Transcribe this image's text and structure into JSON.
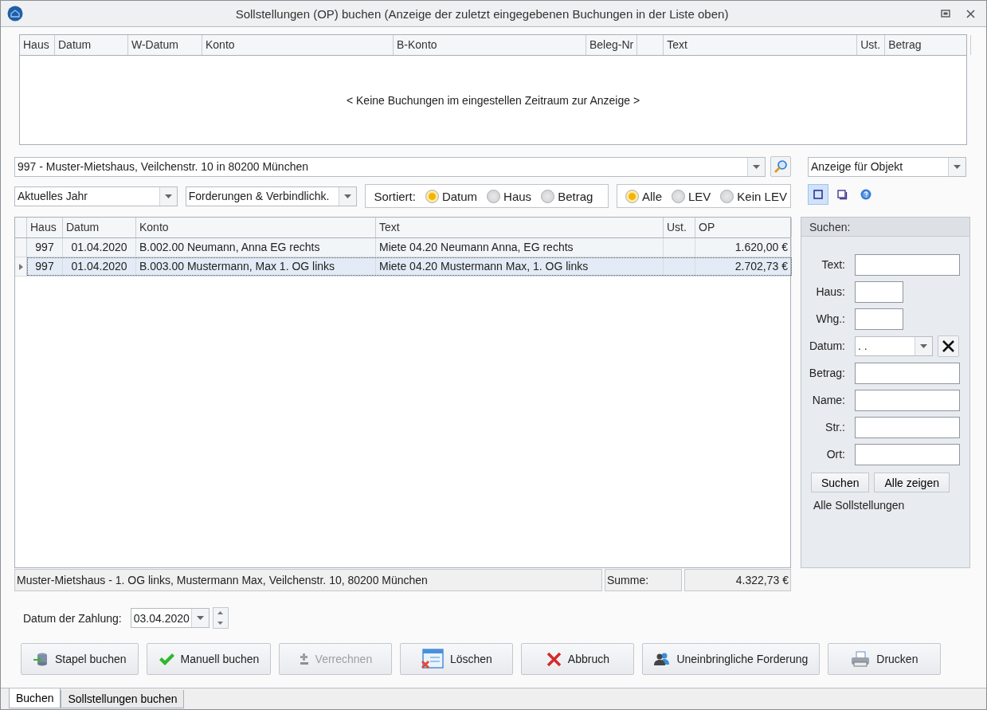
{
  "window": {
    "title": "Sollstellungen (OP) buchen (Anzeige der zuletzt eingegebenen Buchungen in der Liste oben)"
  },
  "top_table": {
    "columns": [
      {
        "label": "Haus"
      },
      {
        "label": "Datum"
      },
      {
        "label": "W-Datum"
      },
      {
        "label": "Konto"
      },
      {
        "label": "B-Konto"
      },
      {
        "label": "Beleg-Nr"
      },
      {},
      {
        "label": "Text"
      },
      {
        "label": "Ust."
      },
      {
        "label": "Betrag"
      }
    ],
    "empty_message": "< Keine Buchungen im eingestellen Zeitraum zur Anzeige >"
  },
  "object_select": {
    "value": "997 - Muster-Mietshaus, Veilchenstr. 10 in 80200 München"
  },
  "view_select": {
    "value": "Anzeige für Objekt"
  },
  "period_select": {
    "value": "Aktuelles Jahr"
  },
  "type_select": {
    "value": "Forderungen & Verbindlichk."
  },
  "sort": {
    "label": "Sortiert:",
    "options": [
      {
        "label": "Datum",
        "selected": true
      },
      {
        "label": "Haus",
        "selected": false
      },
      {
        "label": "Betrag",
        "selected": false
      }
    ]
  },
  "filter": {
    "options": [
      {
        "label": "Alle",
        "selected": true
      },
      {
        "label": "LEV",
        "selected": false
      },
      {
        "label": "Kein LEV",
        "selected": false
      }
    ]
  },
  "view_buttons": [
    {
      "kind": "single",
      "selected": true
    },
    {
      "kind": "stack",
      "selected": false
    },
    {
      "kind": "help",
      "selected": false
    }
  ],
  "grid": {
    "columns": [
      {
        "label": "Haus"
      },
      {
        "label": "Datum"
      },
      {
        "label": "Konto"
      },
      {
        "label": "Text"
      },
      {
        "label": "Ust."
      },
      {
        "label": "OP"
      }
    ],
    "rows": [
      {
        "cells": [
          "997",
          "01.04.2020",
          "B.002.00 Neumann, Anna EG rechts",
          "Miete 04.20 Neumann Anna, EG rechts",
          "",
          "1.620,00 €"
        ],
        "selected": false
      },
      {
        "cells": [
          "997",
          "01.04.2020",
          "B.003.00 Mustermann, Max 1. OG links",
          "Miete 04.20 Mustermann Max, 1. OG links",
          "",
          "2.702,73 €"
        ],
        "selected": true
      }
    ]
  },
  "search_panel": {
    "title": "Suchen:",
    "fields": [
      {
        "label": "Text:",
        "kind": "wide"
      },
      {
        "label": "Haus:",
        "kind": "short"
      },
      {
        "label": "Whg.:",
        "kind": "short"
      },
      {
        "label": "Datum:",
        "kind": "date",
        "value": ". ."
      },
      {
        "label": "Betrag:",
        "kind": "wide"
      },
      {
        "label": "Name:",
        "kind": "wide"
      },
      {
        "label": "Str.:",
        "kind": "wide"
      },
      {
        "label": "Ort:",
        "kind": "wide"
      }
    ],
    "buttons": [
      "Suchen",
      "Alle zeigen"
    ],
    "status": "Alle Sollstellungen"
  },
  "status_bar": {
    "text": "Muster-Mietshaus - 1. OG links, Mustermann Max, Veilchenstr. 10, 80200 München",
    "sum_label": "Summe:",
    "sum_value": "4.322,73 €"
  },
  "payment_date": {
    "label": "Datum der Zahlung:",
    "value": "03.04.2020"
  },
  "buttons": [
    {
      "label": "Stapel buchen",
      "kind": "batch",
      "disabled": false
    },
    {
      "label": "Manuell buchen",
      "kind": "check",
      "disabled": false
    },
    {
      "label": "Verrechnen",
      "kind": "plusminus",
      "disabled": true
    },
    {
      "label": "Löschen",
      "kind": "delete",
      "disabled": false
    },
    {
      "label": "Abbruch",
      "kind": "cross",
      "disabled": false
    },
    {
      "label": "Uneinbringliche Forderung",
      "kind": "people",
      "disabled": false
    },
    {
      "label": "Drucken",
      "kind": "printer",
      "disabled": false
    }
  ],
  "tabs": [
    {
      "label": "Buchen",
      "selected": true
    },
    {
      "label": "Sollstellungen buchen",
      "selected": false
    }
  ]
}
